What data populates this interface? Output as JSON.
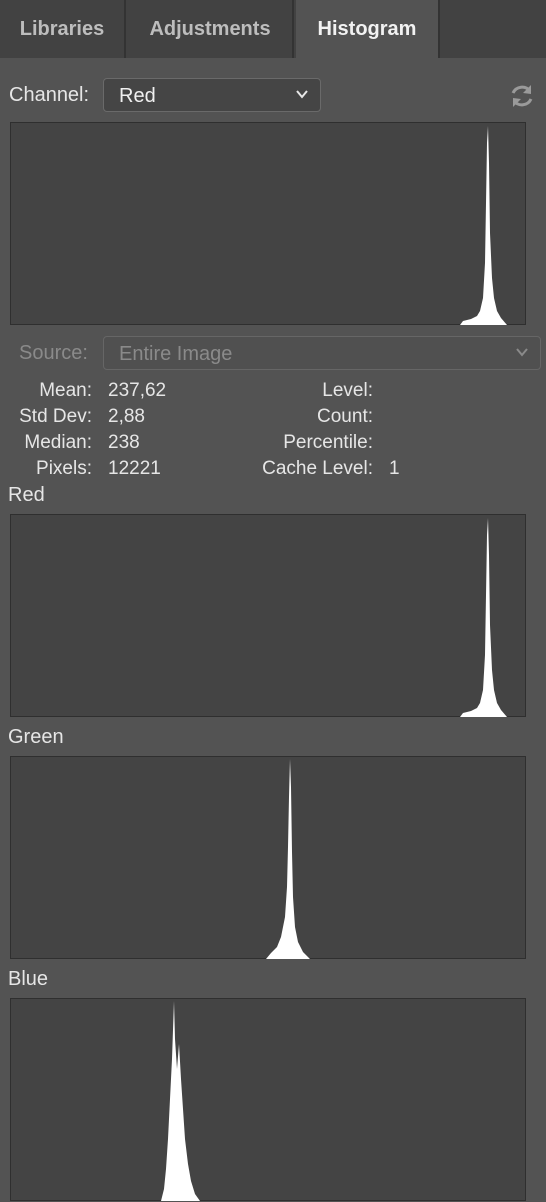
{
  "tabs": [
    {
      "label": "Libraries",
      "active": false
    },
    {
      "label": "Adjustments",
      "active": false
    },
    {
      "label": "Histogram",
      "active": true
    }
  ],
  "channel": {
    "label": "Channel:",
    "value": "Red"
  },
  "source": {
    "label": "Source:",
    "value": "Entire Image",
    "enabled": false
  },
  "stats": {
    "mean_label": "Mean:",
    "mean": "237,62",
    "stddev_label": "Std Dev:",
    "stddev": "2,88",
    "median_label": "Median:",
    "median": "238",
    "pixels_label": "Pixels:",
    "pixels": "12221",
    "level_label": "Level:",
    "level": "",
    "count_label": "Count:",
    "count": "",
    "percentile_label": "Percentile:",
    "percentile": "",
    "cache_label": "Cache Level:",
    "cache": "1"
  },
  "sections": {
    "red": "Red",
    "green": "Green",
    "blue": "Blue"
  },
  "histograms": {
    "main": {
      "channel": "Red",
      "peak_level": 238
    },
    "red": {
      "peak_level": 238
    },
    "green": {
      "peak_level": 139
    },
    "blue": {
      "peak_level": 83
    }
  },
  "colors": {
    "panel_bg": "#535353",
    "histogram_bg": "#444444",
    "histogram_fill": "#ffffff"
  },
  "icons": {
    "refresh": "refresh-icon",
    "dropdown": "chevron-down-icon"
  }
}
